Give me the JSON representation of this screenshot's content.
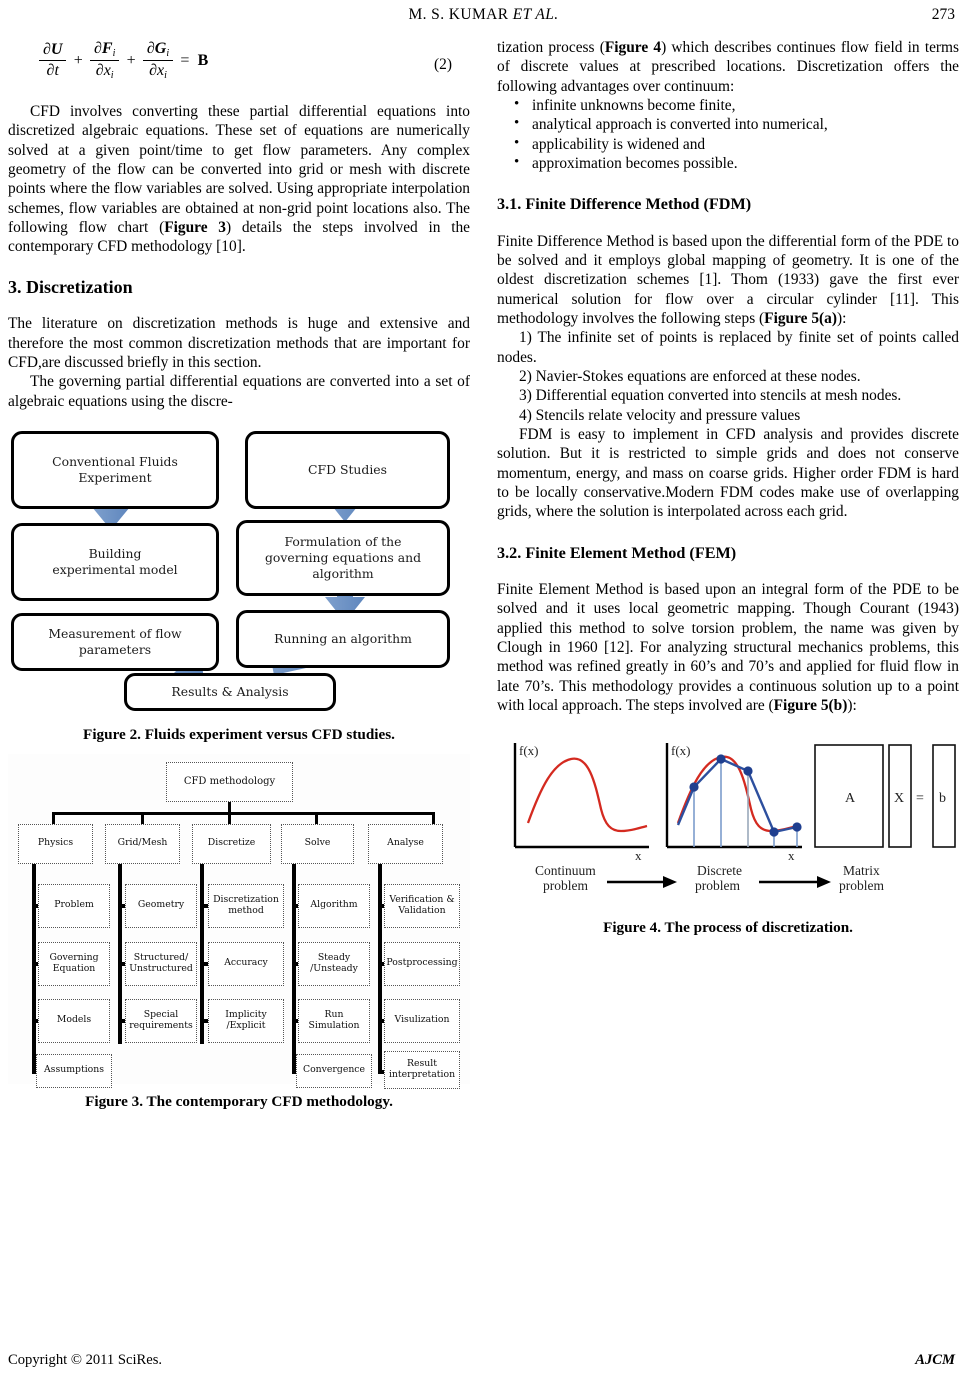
{
  "header": {
    "authors": "M. S. KUMAR",
    "et_al": "ET   AL.",
    "page_number": "273"
  },
  "equation": {
    "number": "(2)",
    "latex_like": "∂U/∂t + ∂Fᵢ/∂xᵢ + ∂Gᵢ/∂xᵢ = B",
    "terms": {
      "n1": "∂U",
      "d1": "∂t",
      "n2": "∂F",
      "d2": "∂x",
      "n3": "∂G",
      "d3": "∂x",
      "rhs": "B",
      "sub": "i",
      "plus": "+",
      "equals": "="
    }
  },
  "left_column": {
    "para_cfd_involves": "CFD involves converting these partial differential equations into discretized algebraic equations. These set of equations are numerically solved at a given point/time to get flow parameters. Any complex geometry of the flow can be converted into grid or mesh with discrete points where the flow variables are solved. Using appropriate interpolation schemes, flow variables are obtained at non-grid point locations also. The following flow chart (Figure 3) details the steps involved in the contemporary CFD methodology [10].",
    "para_cfd_involves_pre": "CFD involves converting these partial differential equations into discretized algebraic equations. These set of equations are numerically solved at a given point/time to get flow parameters. Any complex geometry of the flow can be converted into grid or mesh with discrete points where the flow variables are solved. Using appropriate interpolation schemes, flow variables are obtained at non-grid point locations also. The following flow chart (",
    "para_cfd_involves_figref": "Figure 3",
    "para_cfd_involves_post": ") details the steps involved in the contemporary CFD methodology [10].",
    "heading_discretization": "3. Discretization",
    "para_literature": "The literature on discretization methods is huge and extensive and therefore the most common discretization methods that are important for CFD,are discussed briefly in this section.",
    "para_governing": "The governing partial differential equations are converted into a set of algebraic equations using the discre-"
  },
  "right_column": {
    "para_tization_pre": "tization process (",
    "para_tization_figref": "Figure 4",
    "para_tization_post": ") which describes continues flow field in terms of discrete values at prescribed locations. Discretization offers the following advantages over continuum:",
    "bullets": [
      "infinite unknowns become finite,",
      "analytical approach is converted into numerical,",
      "applicability is widened and",
      "approximation becomes possible."
    ],
    "heading_fdm": "3.1. Finite Difference Method (FDM)",
    "para_fdm_pre": "Finite Difference Method is based upon the differential form of the PDE to be solved and it employs global mapping of geometry. It is one of the oldest discretization schemes [1]. Thom (1933) gave the first ever numerical solution for flow over a circular cylinder [11]. This methodology involves the following steps (",
    "para_fdm_figref": "Figure 5(a)",
    "para_fdm_post": "):",
    "fdm_steps": [
      "1) The infinite set of points is replaced by finite set of points called nodes.",
      "2) Navier-Stokes equations are enforced at these nodes.",
      "3) Differential equation converted into stencils at mesh nodes.",
      "4) Stencils relate velocity and pressure values"
    ],
    "para_fdm_summary": "FDM is easy to implement in CFD analysis and provides discrete solution. But it is restricted to simple grids and does not conserve momentum, energy, and mass on coarse grids. Higher order FDM is hard to be locally conservative.Modern FDM codes make use of overlapping grids, where the solution is interpolated across each grid.",
    "heading_fem": "3.2. Finite Element Method (FEM)",
    "para_fem_pre": "Finite Element Method is based upon an integral form of the PDE to be solved and it uses local geometric mapping. Though Courant (1943) applied this method to solve torsion problem, the name was given by Clough in 1960 [12]. For analyzing structural mechanics problems, this method was refined greatly in 60’s and 70’s and applied for fluid flow in late 70’s. This methodology provides a continuous solution up to a point with local approach. The steps involved are (",
    "para_fem_figref": "Figure 5(b)",
    "para_fem_post": "):"
  },
  "figure2": {
    "caption": "Figure 2. Fluids experiment versus CFD studies.",
    "arrow_color": "#6f94c8",
    "boxes": [
      {
        "id": "conventional-fluids-experiment",
        "label": "Conventional Fluids\nExperiment"
      },
      {
        "id": "cfd-studies",
        "label": "CFD Studies"
      },
      {
        "id": "building-experimental-model",
        "label": "Building\nexperimental model"
      },
      {
        "id": "formulation-governing-equations",
        "label": "Formulation of the\ngoverning equations and\nalgorithm"
      },
      {
        "id": "measurement-of-flow-parameters",
        "label": "Measurement of flow\nparameters"
      },
      {
        "id": "running-an-algorithm",
        "label": "Running an algorithm"
      },
      {
        "id": "results-and-analysis",
        "label": "Results & Analysis"
      }
    ]
  },
  "figure3": {
    "caption": "Figure 3. The contemporary CFD methodology.",
    "root": "CFD methodology",
    "columns": [
      {
        "head": "Physics",
        "items": [
          "Problem",
          "Governing\nEquation",
          "Models",
          "Assumptions"
        ]
      },
      {
        "head": "Grid/Mesh",
        "items": [
          "Geometry",
          "Structured/\nUnstructured",
          "Special\nrequirements"
        ]
      },
      {
        "head": "Discretize",
        "items": [
          "Discretization\nmethod",
          "Accuracy",
          "Implicity\n/Explicit"
        ]
      },
      {
        "head": "Solve",
        "items": [
          "Algorithm",
          "Steady\n/Unsteady",
          "Run\nSimulation",
          "Convergence"
        ]
      },
      {
        "head": "Analyse",
        "items": [
          "Verification &\nValidation",
          "Postprocessing",
          "Visulization",
          "Result\ninterpretation"
        ]
      }
    ]
  },
  "figure4": {
    "caption": "Figure 4. The process of discretization.",
    "curve_color": "#d42a20",
    "discrete_color": "#2d4f9e",
    "node_color": "#1f3f8f",
    "panels": [
      {
        "id": "continuum",
        "axis_y_label": "f(x)",
        "axis_x_label": "x",
        "caption": "Continuum\nproblem"
      },
      {
        "id": "discrete",
        "axis_y_label": "f(x)",
        "axis_x_label": "x",
        "caption": "Discrete\nproblem"
      },
      {
        "id": "matrix",
        "caption": "Matrix\nproblem",
        "matrix_a": "A",
        "matrix_x": "X",
        "equals": "=",
        "matrix_b": "b"
      }
    ]
  },
  "footer": {
    "copyright": "Copyright © 2011 SciRes.",
    "journal": "AJCM"
  }
}
